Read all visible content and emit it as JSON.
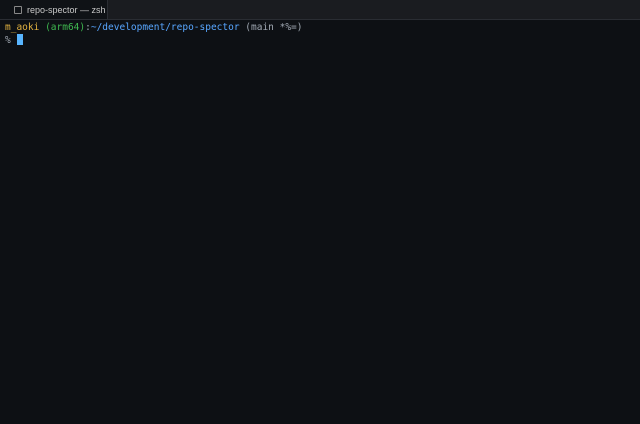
{
  "tab": {
    "title": "repo-spector — zsh",
    "icon": "terminal-icon"
  },
  "prompt": {
    "user": "m_aoki",
    "arch": "(arm64)",
    "sep": ":",
    "path": "~/development/repo-spector",
    "git": "(main *%=)",
    "symbol": "%"
  }
}
